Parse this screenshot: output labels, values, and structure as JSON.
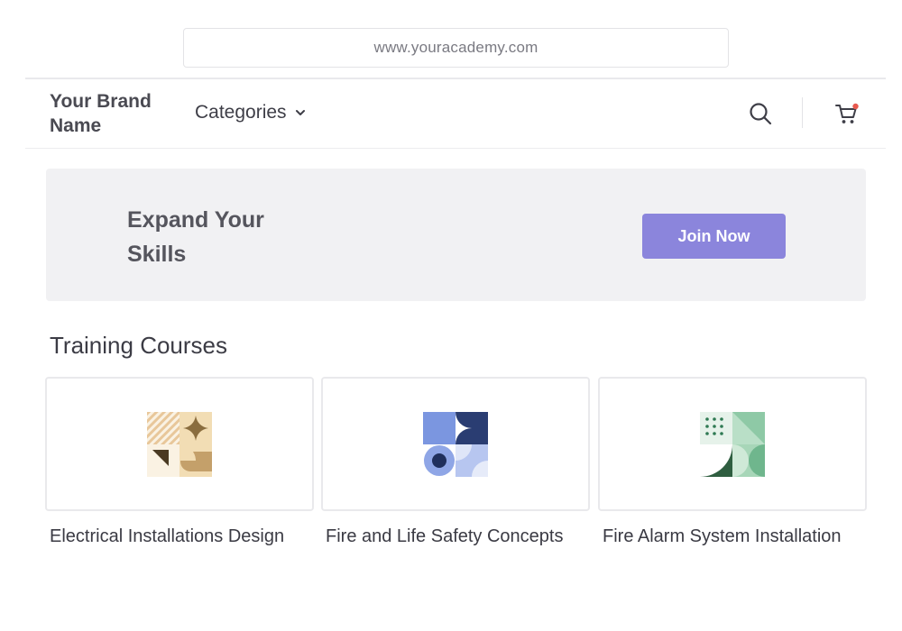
{
  "browser": {
    "url": "www.youracademy.com"
  },
  "nav": {
    "brand": "Your Brand Name",
    "categories_label": "Categories",
    "icons": {
      "search": "search-icon",
      "cart": "cart-icon",
      "dropdown": "chevron-down-icon"
    },
    "cart_badge_color": "#e85a4f"
  },
  "hero": {
    "title": "Expand Your Skills",
    "cta_label": "Join Now",
    "cta_color": "#8b85dc",
    "background": "#f1f1f3"
  },
  "courses_section": {
    "title": "Training Courses",
    "courses": [
      {
        "title": "Electrical Installations Design",
        "thumbnail": "tan-geometric-pattern"
      },
      {
        "title": "Fire and Life Safety Concepts",
        "thumbnail": "blue-geometric-pattern"
      },
      {
        "title": "Fire Alarm System Installation",
        "thumbnail": "green-geometric-pattern"
      }
    ]
  }
}
